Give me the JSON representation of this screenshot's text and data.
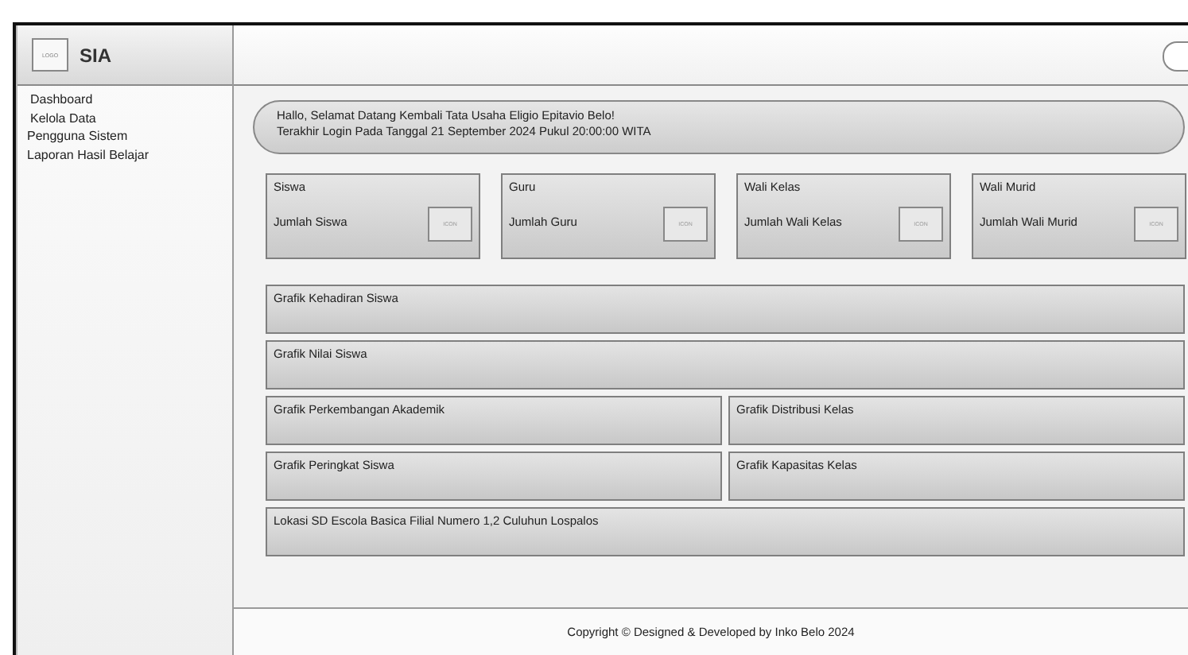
{
  "header": {
    "logo_label": "LOGO",
    "app_title": "SIA"
  },
  "sidebar": {
    "items": [
      "Dashboard",
      "Kelola Data",
      "Pengguna Sistem",
      "Laporan Hasil Belajar"
    ]
  },
  "greeting": {
    "lines": [
      "Hallo, Selamat Datang Kembali Tata Usaha Eligio Epitavio Belo!",
      "Terakhir Login Pada Tanggal 21 September 2024 Pukul 20:00:00 WITA"
    ]
  },
  "stat_cards": [
    {
      "title": "Siswa",
      "label": "Jumlah Siswa",
      "icon_label": "ICON"
    },
    {
      "title": "Guru",
      "label": "Jumlah Guru",
      "icon_label": "ICON"
    },
    {
      "title": "Wali Kelas",
      "label": "Jumlah Wali Kelas",
      "icon_label": "ICON"
    },
    {
      "title": "Wali Murid",
      "label": "Jumlah Wali Murid",
      "icon_label": "ICON"
    }
  ],
  "panels": [
    {
      "title": "Grafik Kehadiran Siswa",
      "kind": "full"
    },
    {
      "title": "Grafik Nilai Siswa",
      "kind": "full"
    },
    {
      "title": "Grafik Perkembangan Akademik",
      "kind": "half"
    },
    {
      "title": "Grafik Distribusi Kelas",
      "kind": "half"
    },
    {
      "title": "Grafik Peringkat Siswa",
      "kind": "half"
    },
    {
      "title": "Grafik Kapasitas Kelas",
      "kind": "half"
    },
    {
      "title": "Lokasi SD Escola Basica Filial Numero 1,2 Culuhun Lospalos",
      "kind": "full"
    }
  ],
  "footer": {
    "text": "Copyright © Designed & Developed by Inko Belo 2024"
  }
}
